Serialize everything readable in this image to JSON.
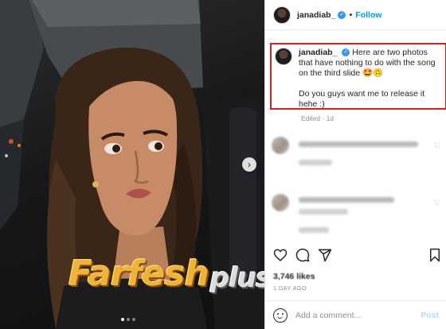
{
  "post": {
    "username": "janadiab_",
    "separator": "•",
    "follow_label": "Follow",
    "verified_glyph": "✓",
    "caption_line_1": "Here are two photos that have nothing to do with the song on the third slide 🤩🙃",
    "caption_line_2": "Do you guys want me to release it hehe :)",
    "edited": "Edited · 1d",
    "likes": "3,746 likes",
    "time_ago": "1 DAY AGO",
    "comment_placeholder": "Add a comment...",
    "post_label": "Post",
    "highlight_color": "#d6201f",
    "accent": "#0095f6"
  },
  "photo": {
    "next_arrow": "›",
    "carousel_dots": 3,
    "carousel_active": 1,
    "watermark_main": "Farfesh",
    "watermark_sub": "plus.com"
  },
  "comment_reaction_glyph": "♡",
  "icons": {
    "like": "heart-icon",
    "comment": "speech-bubble-icon",
    "share": "paper-plane-icon",
    "save": "bookmark-icon",
    "emoji": "smiley-icon",
    "verified": "verified-badge-icon",
    "next": "chevron-right-icon"
  }
}
